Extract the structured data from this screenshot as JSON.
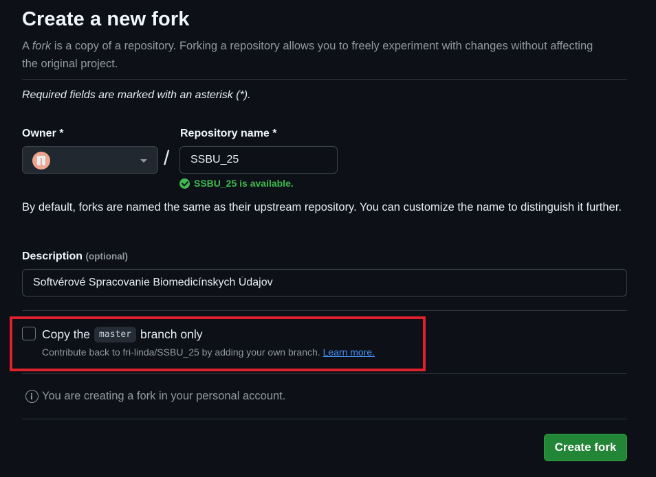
{
  "header": {
    "title": "Create a new fork",
    "subtitle_prefix": "A ",
    "subtitle_em": "fork",
    "subtitle_rest": " is a copy of a repository. Forking a repository allows you to freely experiment with changes without affecting the original project."
  },
  "required_note": "Required fields are marked with an asterisk (*).",
  "owner": {
    "label": "Owner *",
    "separator": "/"
  },
  "repository": {
    "label": "Repository name *",
    "value": "SSBU_25",
    "availability": "SSBU_25 is available."
  },
  "naming_hint": "By default, forks are named the same as their upstream repository. You can customize the name to distinguish it further.",
  "description": {
    "label": "Description",
    "optional": "(optional)",
    "value": "Softvérové Spracovanie Biomedicínskych Údajov"
  },
  "copy_branch": {
    "checked": false,
    "prefix": "Copy the",
    "branch": "master",
    "suffix": "branch only",
    "sub_text": "Contribute back to fri-linda/SSBU_25 by adding your own branch.",
    "learn_more": "Learn more."
  },
  "info_text": "You are creating a fork in your personal account.",
  "submit_label": "Create fork",
  "colors": {
    "background": "#0d1117",
    "primary_button": "#238636",
    "success": "#3fb950",
    "link": "#4493f8",
    "highlight_box": "#e0212b"
  }
}
